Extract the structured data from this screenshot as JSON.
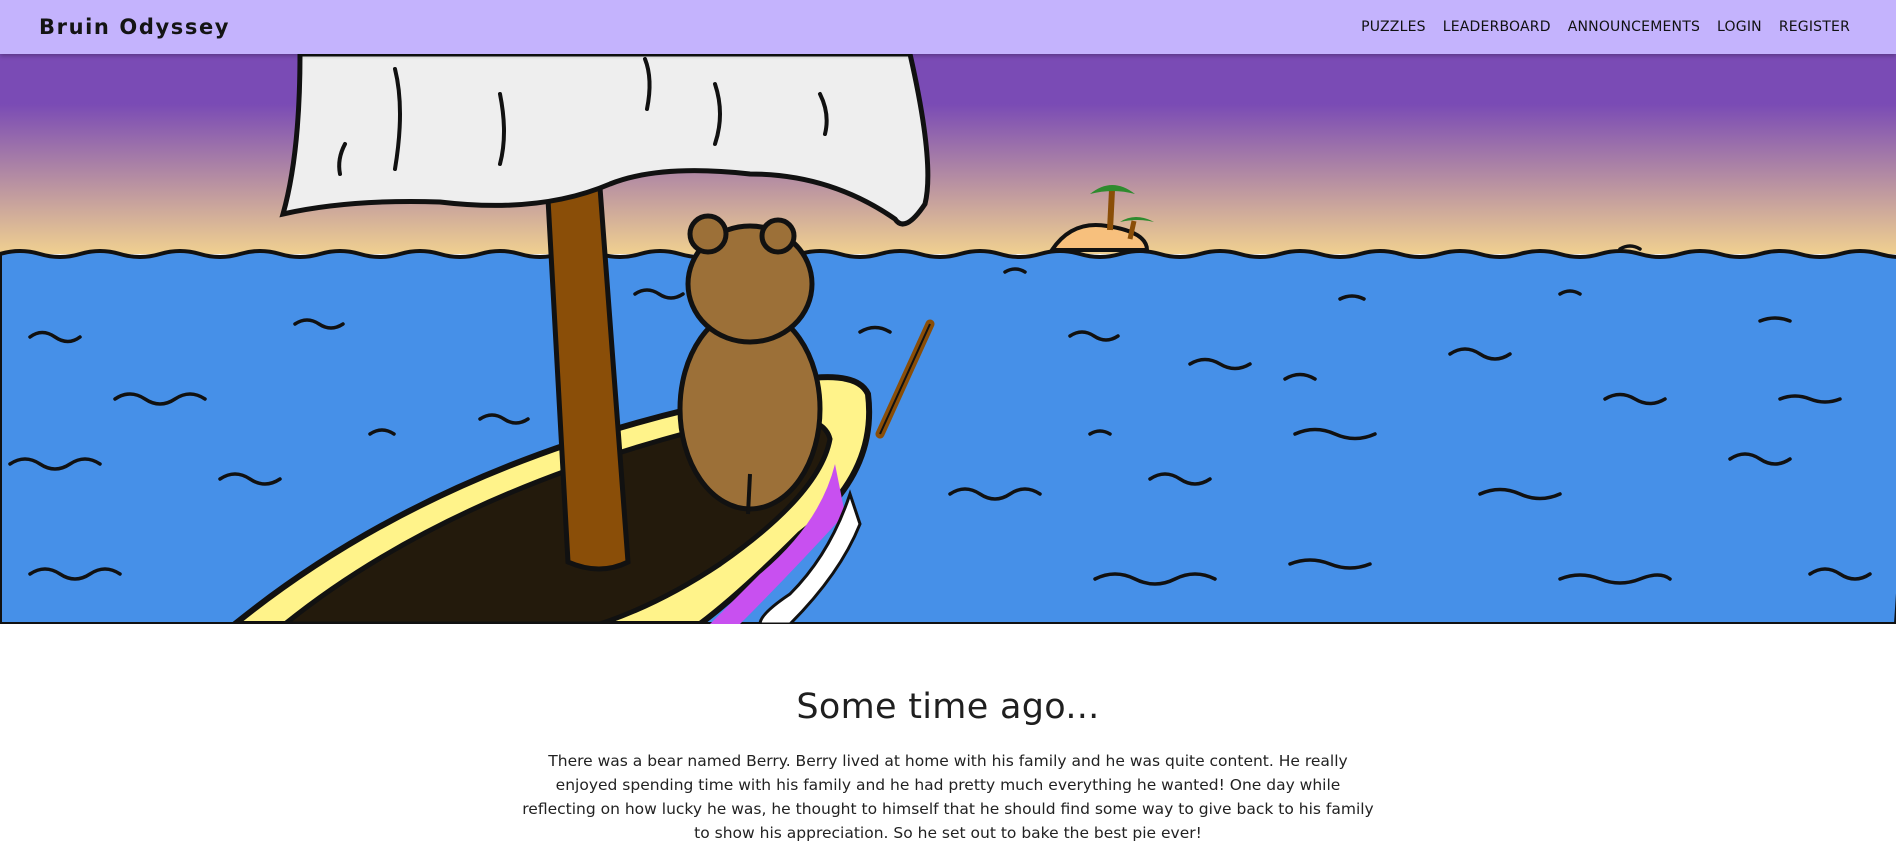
{
  "navbar": {
    "brand": "Bruin Odyssey",
    "links": [
      {
        "label": "PUZZLES"
      },
      {
        "label": "LEADERBOARD"
      },
      {
        "label": "ANNOUNCEMENTS"
      },
      {
        "label": "LOGIN"
      },
      {
        "label": "REGISTER"
      }
    ],
    "background": "#c4b3fd"
  },
  "hero": {
    "colors": {
      "sky_top": "#7a4bb5",
      "sky_horizon": "#f0d090",
      "sea": "#4690e8",
      "sail": "#eeeeee",
      "mast": "#8a4e08",
      "bear": "#9c7038",
      "hull": "#fff38a",
      "hull_stripe": "#c850f0",
      "boat_deck": "#231a0c",
      "island_sand": "#f7c07d",
      "palm": "#2e8b2e"
    }
  },
  "story": {
    "heading": "Some time ago...",
    "paragraph": "There was a bear named Berry. Berry lived at home with his family and he was quite content. He really enjoyed spending time with his family and he had pretty much everything he wanted! One day while reflecting on how lucky he was, he thought to himself that he should find some way to give back to his family to show his appreciation. So he set out to bake the best pie ever!"
  }
}
